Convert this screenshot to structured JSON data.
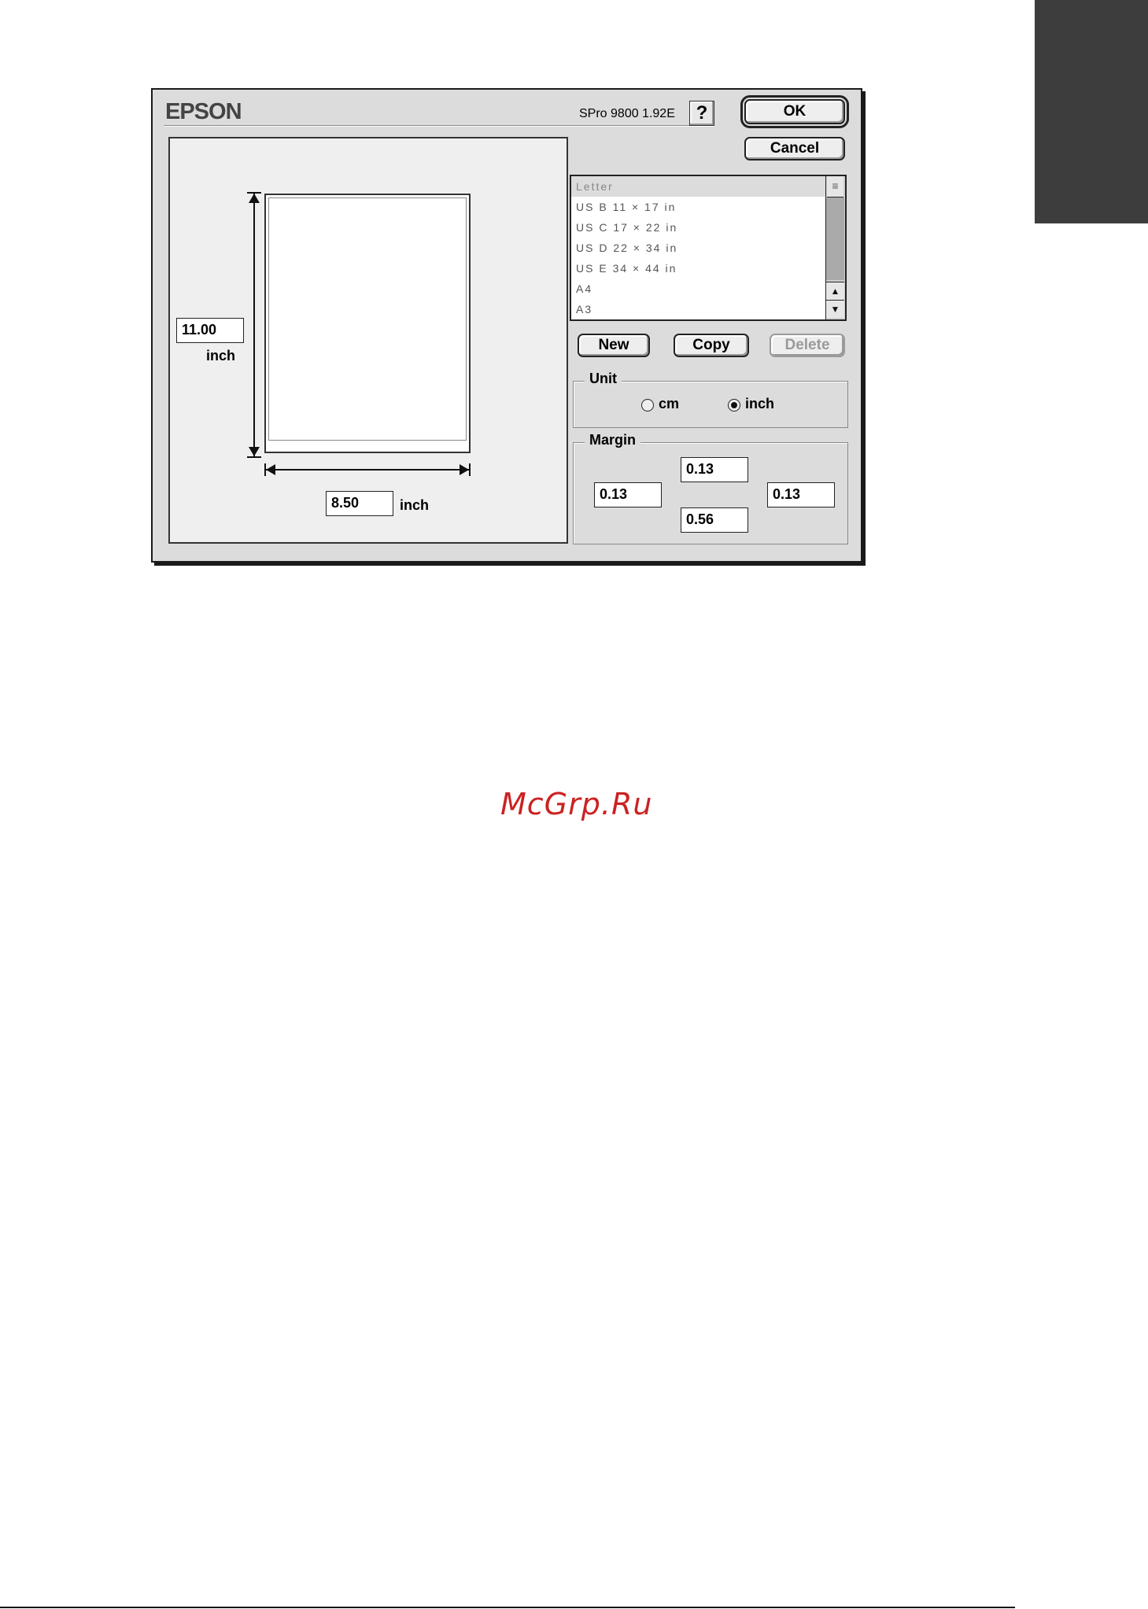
{
  "dialog": {
    "brand": "EPSON",
    "driver_version": "SPro 9800 1.92E",
    "help_label": "?",
    "ok_label": "OK",
    "cancel_label": "Cancel"
  },
  "preview": {
    "height_value": "11.00",
    "height_unit": "inch",
    "width_value": "8.50",
    "width_unit": "inch"
  },
  "paper_sizes": {
    "items": [
      "Letter",
      "US B 11 × 17 in",
      "US C 17 × 22 in",
      "US D 22 × 34 in",
      "US E 34 × 44 in",
      "A4",
      "A3"
    ],
    "selected": "Letter"
  },
  "actions": {
    "new_label": "New",
    "copy_label": "Copy",
    "delete_label": "Delete"
  },
  "unit": {
    "title": "Unit",
    "cm_label": "cm",
    "inch_label": "inch",
    "selected": "inch"
  },
  "margin": {
    "title": "Margin",
    "top": "0.13",
    "left": "0.13",
    "right": "0.13",
    "bottom": "0.56"
  },
  "watermark": "McGrp.Ru",
  "colors": {
    "dialog_bg": "#dcdcdc",
    "watermark": "#cc2222",
    "side_tab": "#3d3d3d"
  }
}
